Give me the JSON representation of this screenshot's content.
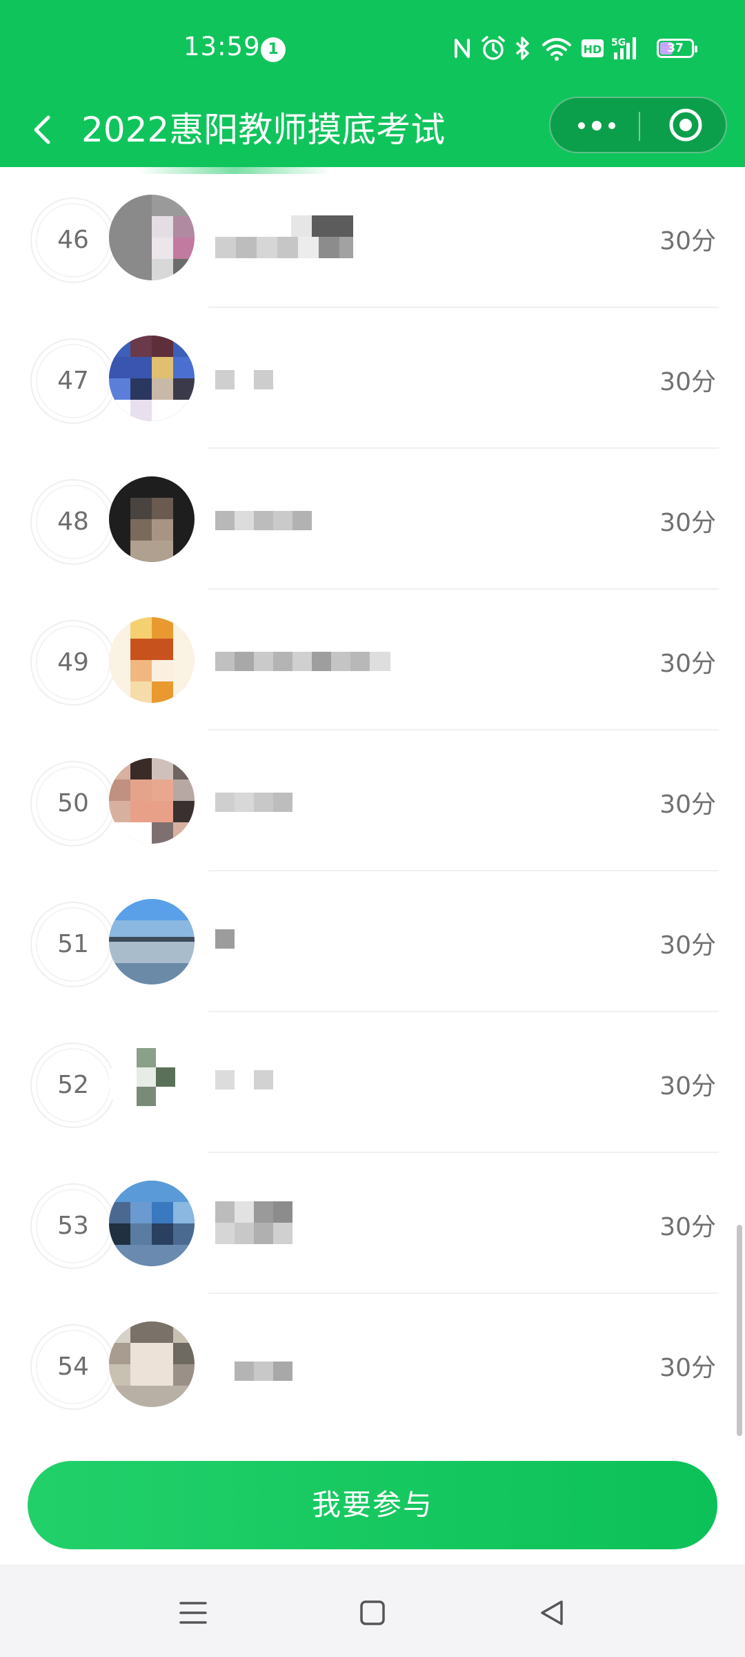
{
  "status_bar": {
    "time": "13:59",
    "notification_count": "1",
    "battery_level": "37",
    "icons": [
      "nfc-icon",
      "alarm-icon",
      "bluetooth-icon",
      "wifi-icon",
      "hd-icon",
      "5g-signal-icon",
      "battery-icon"
    ]
  },
  "title_bar": {
    "title": "2022惠阳教师摸底考试"
  },
  "leaderboard": {
    "rows": [
      {
        "rank": "46",
        "score": "30分"
      },
      {
        "rank": "47",
        "score": "30分"
      },
      {
        "rank": "48",
        "score": "30分"
      },
      {
        "rank": "49",
        "score": "30分"
      },
      {
        "rank": "50",
        "score": "30分"
      },
      {
        "rank": "51",
        "score": "30分"
      },
      {
        "rank": "52",
        "score": "30分"
      },
      {
        "rank": "53",
        "score": "30分"
      },
      {
        "rank": "54",
        "score": "30分"
      }
    ]
  },
  "join_button": {
    "label": "我要参与"
  },
  "colors": {
    "brand_green": "#10c45c",
    "capsule_green": "#0c9f4b",
    "score_gray": "#707070"
  }
}
